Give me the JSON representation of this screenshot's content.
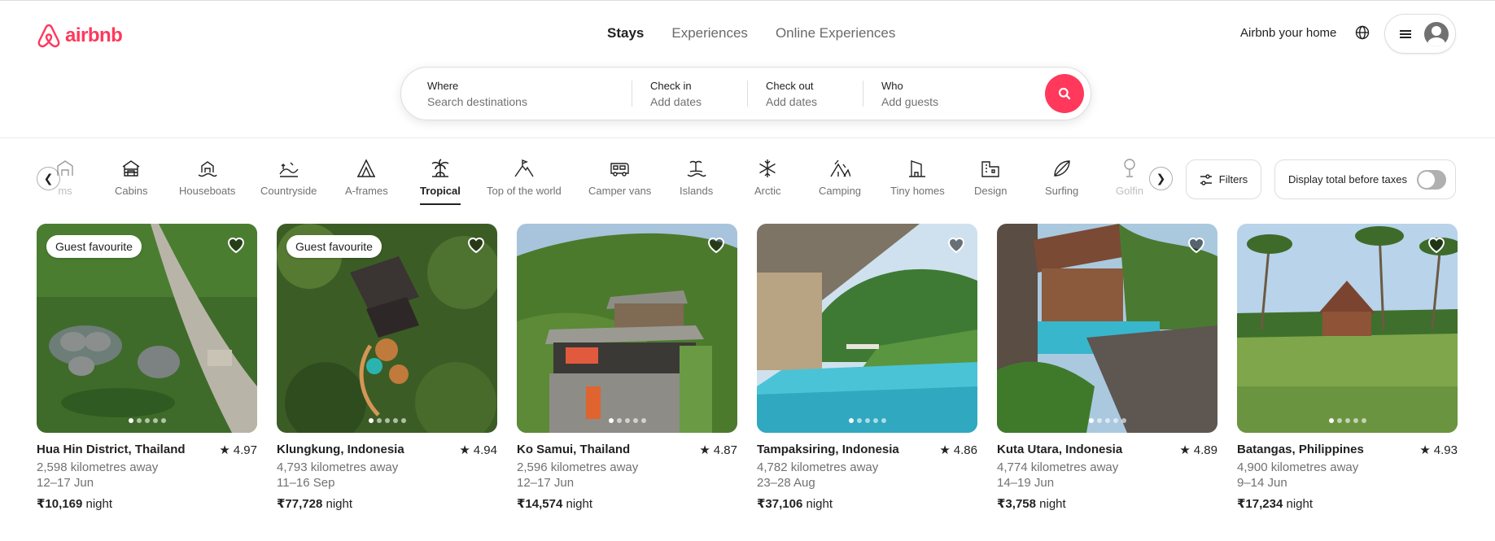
{
  "brand": {
    "name": "airbnb",
    "color": "#ff385c"
  },
  "nav": {
    "tabs": [
      {
        "label": "Stays",
        "active": true
      },
      {
        "label": "Experiences"
      },
      {
        "label": "Online Experiences"
      }
    ]
  },
  "header": {
    "host_link": "Airbnb your home",
    "globe_icon": "globe-icon",
    "menu_icon": "hamburger-icon"
  },
  "search": {
    "where": {
      "label": "Where",
      "placeholder": "Search destinations"
    },
    "check_in": {
      "label": "Check in",
      "placeholder": "Add dates"
    },
    "check_out": {
      "label": "Check out",
      "placeholder": "Add dates"
    },
    "who": {
      "label": "Who",
      "placeholder": "Add guests"
    },
    "button_icon": "search-icon"
  },
  "categories": {
    "items": [
      {
        "label": "ms",
        "icon": "farms-icon"
      },
      {
        "label": "Cabins",
        "icon": "cabin-icon"
      },
      {
        "label": "Houseboats",
        "icon": "houseboat-icon"
      },
      {
        "label": "Countryside",
        "icon": "countryside-icon"
      },
      {
        "label": "A-frames",
        "icon": "a-frame-icon"
      },
      {
        "label": "Tropical",
        "icon": "palm-tree-icon",
        "active": true
      },
      {
        "label": "Top of the world",
        "icon": "mountain-flag-icon"
      },
      {
        "label": "Camper vans",
        "icon": "camper-van-icon"
      },
      {
        "label": "Islands",
        "icon": "island-icon"
      },
      {
        "label": "Arctic",
        "icon": "snowflake-icon"
      },
      {
        "label": "Camping",
        "icon": "tent-icon"
      },
      {
        "label": "Tiny homes",
        "icon": "tiny-home-icon"
      },
      {
        "label": "Design",
        "icon": "design-icon"
      },
      {
        "label": "Surfing",
        "icon": "surfboard-icon"
      },
      {
        "label": "Golfin",
        "icon": "golf-icon"
      }
    ],
    "filters_label": "Filters",
    "taxes_label": "Display total before taxes",
    "taxes_on": false
  },
  "listings": [
    {
      "title": "Hua Hin District, Thailand",
      "rating": "4.97",
      "distance": "2,598 kilometres away",
      "dates": "12–17 Jun",
      "price": "₹10,169",
      "unit": "night",
      "badge": "Guest favourite"
    },
    {
      "title": "Klungkung, Indonesia",
      "rating": "4.94",
      "distance": "4,793 kilometres away",
      "dates": "11–16 Sep",
      "price": "₹77,728",
      "unit": "night",
      "badge": "Guest favourite"
    },
    {
      "title": "Ko Samui, Thailand",
      "rating": "4.87",
      "distance": "2,596 kilometres away",
      "dates": "12–17 Jun",
      "price": "₹14,574",
      "unit": "night",
      "badge": ""
    },
    {
      "title": "Tampaksiring, Indonesia",
      "rating": "4.86",
      "distance": "4,782 kilometres away",
      "dates": "23–28 Aug",
      "price": "₹37,106",
      "unit": "night",
      "badge": ""
    },
    {
      "title": "Kuta Utara, Indonesia",
      "rating": "4.89",
      "distance": "4,774 kilometres away",
      "dates": "14–19 Jun",
      "price": "₹3,758",
      "unit": "night",
      "badge": ""
    },
    {
      "title": "Batangas, Philippines",
      "rating": "4.93",
      "distance": "4,900 kilometres away",
      "dates": "9–14 Jun",
      "price": "₹17,234",
      "unit": "night",
      "badge": ""
    }
  ]
}
